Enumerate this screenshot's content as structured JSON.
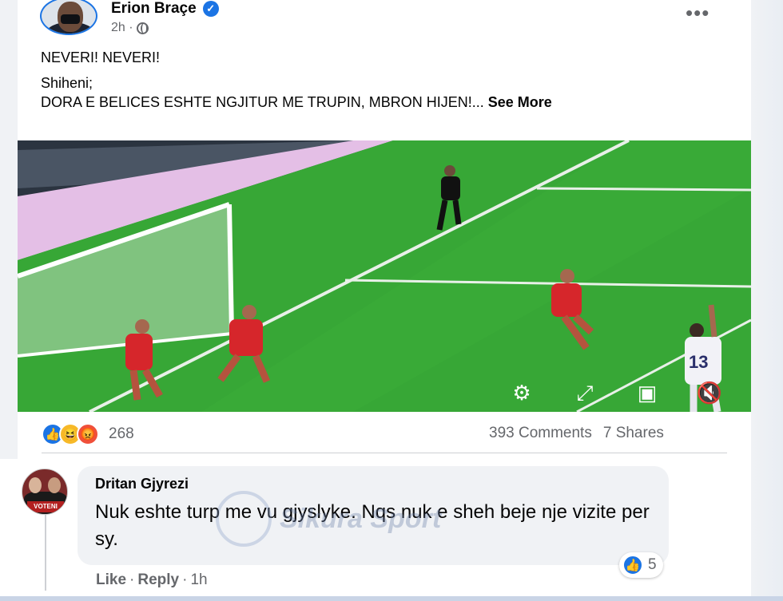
{
  "post": {
    "author": "Erion Braçe",
    "time": "2h ·",
    "text_line1": "NEVERI! NEVERI!",
    "text_line2": "Shiheni;",
    "text_line3": "DORA E BELICES ESHTE NGJITUR ME TRUPIN, MBRON HIJEN!...",
    "see_more": "See More",
    "more_icon": "more-horizontal-icon",
    "privacy_icon": "globe-icon"
  },
  "video": {
    "player_number": "13",
    "controls": [
      "settings-icon",
      "fullscreen-icon",
      "picture-in-picture-icon",
      "mute-icon"
    ]
  },
  "engagement": {
    "reactions": [
      "like",
      "haha",
      "angry"
    ],
    "reaction_count": "268",
    "comments": "393 Comments",
    "shares": "7 Shares"
  },
  "comment": {
    "author": "Dritan Gjyrezi",
    "text": "Nuk eshte turp me vu gjyslyke. Nqs nuk e sheh beje nje vizite per sy.",
    "avatar_tag": "VOTENI",
    "like_label": "Like",
    "reply_label": "Reply",
    "time": "1h",
    "reaction_count": "5"
  },
  "watermark": {
    "text": "Sikura Sport"
  },
  "colors": {
    "accent": "#1b74e4",
    "text": "#050505",
    "secondary_text": "#65676b",
    "pitch": "#36a535"
  }
}
